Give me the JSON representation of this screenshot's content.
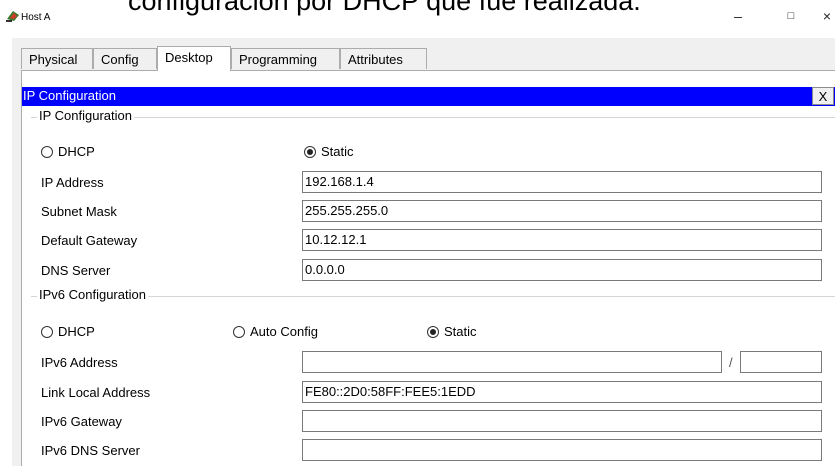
{
  "overlay": {
    "caption": "configuración por DHCP que fue realizada."
  },
  "window": {
    "title": "Host A",
    "minimize": "–",
    "maximize": "□",
    "close": "×"
  },
  "tabs": [
    "Physical",
    "Config",
    "Desktop",
    "Programming",
    "Attributes"
  ],
  "dialog": {
    "title": "IP Configuration",
    "close": "X"
  },
  "ipv4": {
    "legend": "IP Configuration",
    "dhcp": "DHCP",
    "static": "Static",
    "selected": "Static",
    "ip_label": "IP Address",
    "ip_value": "192.168.1.4",
    "mask_label": "Subnet Mask",
    "mask_value": "255.255.255.0",
    "gw_label": "Default Gateway",
    "gw_value": "10.12.12.1",
    "dns_label": "DNS Server",
    "dns_value": "0.0.0.0"
  },
  "ipv6": {
    "legend": "IPv6 Configuration",
    "dhcp": "DHCP",
    "auto": "Auto Config",
    "static": "Static",
    "selected": "Static",
    "addr_label": "IPv6 Address",
    "addr_value": "",
    "prefix_value": "",
    "slash": "/",
    "ll_label": "Link Local Address",
    "ll_value": "FE80::2D0:58FF:FEE5:1EDD",
    "gw_label": "IPv6 Gateway",
    "gw_value": "",
    "dns_label": "IPv6 DNS Server",
    "dns_value": ""
  }
}
